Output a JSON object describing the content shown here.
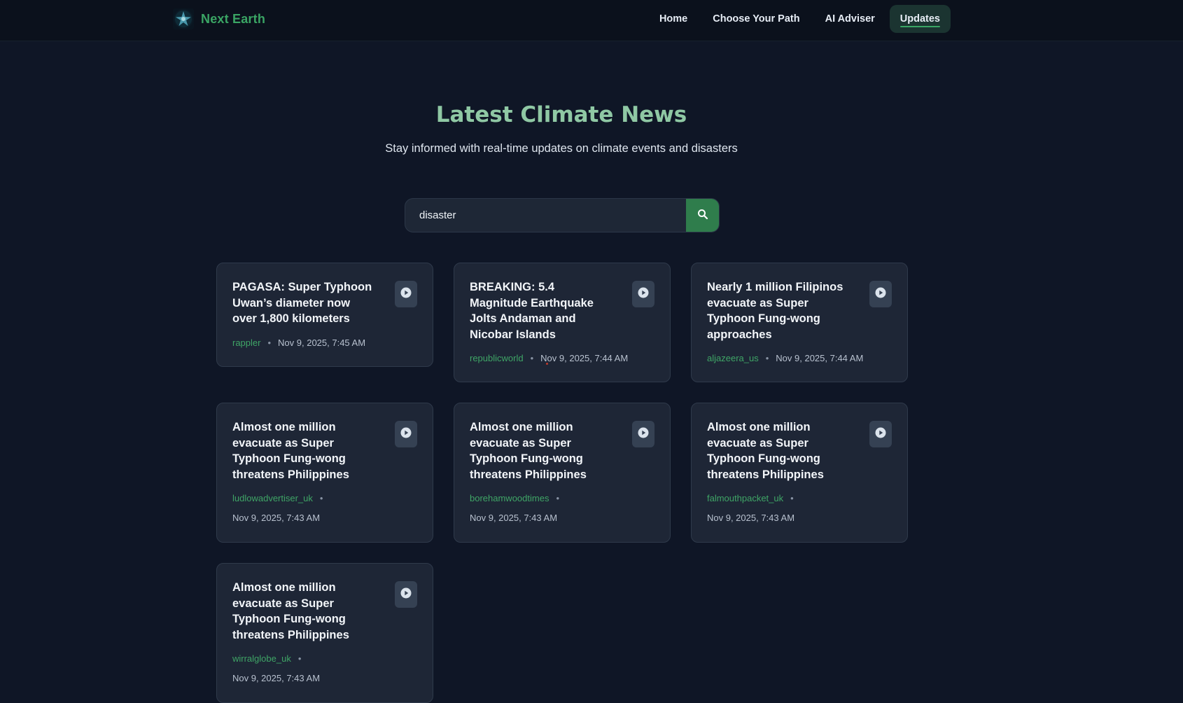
{
  "brand": {
    "name": "Next Earth",
    "logo_icon": "star-globe-icon"
  },
  "nav": {
    "items": [
      {
        "label": "Home",
        "active": false
      },
      {
        "label": "Choose Your Path",
        "active": false
      },
      {
        "label": "AI Adviser",
        "active": false
      },
      {
        "label": "Updates",
        "active": true
      }
    ]
  },
  "hero": {
    "title": "Latest Climate News",
    "subtitle": "Stay informed with real-time updates on climate events and disasters"
  },
  "search": {
    "value": "disaster",
    "button_icon": "search-icon"
  },
  "colors": {
    "accent": "#3aa564",
    "title": "#8fc8a4",
    "background": "#0f1626",
    "card": "#1e2636"
  },
  "news": [
    {
      "title": "PAGASA: Super Typhoon Uwan’s diameter now over 1,800 kilometers",
      "source": "rappler",
      "date": "Nov 9, 2025, 7:45 AM"
    },
    {
      "title": "BREAKING: 5.4 Magnitude Earthquake Jolts Andaman and Nicobar Islands",
      "source": "republicworld",
      "date": "Nov 9, 2025, 7:44 AM"
    },
    {
      "title": "Nearly 1 million Filipinos evacuate as Super Typhoon Fung-wong approaches",
      "source": "aljazeera_us",
      "date": "Nov 9, 2025, 7:44 AM"
    },
    {
      "title": "Almost one million evacuate as Super Typhoon Fung-wong threatens Philippines",
      "source": "ludlowadvertiser_uk",
      "date": "Nov 9, 2025, 7:43 AM"
    },
    {
      "title": "Almost one million evacuate as Super Typhoon Fung-wong threatens Philippines",
      "source": "borehamwoodtimes",
      "date": "Nov 9, 2025, 7:43 AM"
    },
    {
      "title": "Almost one million evacuate as Super Typhoon Fung-wong threatens Philippines",
      "source": "falmouthpacket_uk",
      "date": "Nov 9, 2025, 7:43 AM"
    },
    {
      "title": "Almost one million evacuate as Super Typhoon Fung-wong threatens Philippines",
      "source": "wirralglobe_uk",
      "date": "Nov 9, 2025, 7:43 AM"
    }
  ]
}
